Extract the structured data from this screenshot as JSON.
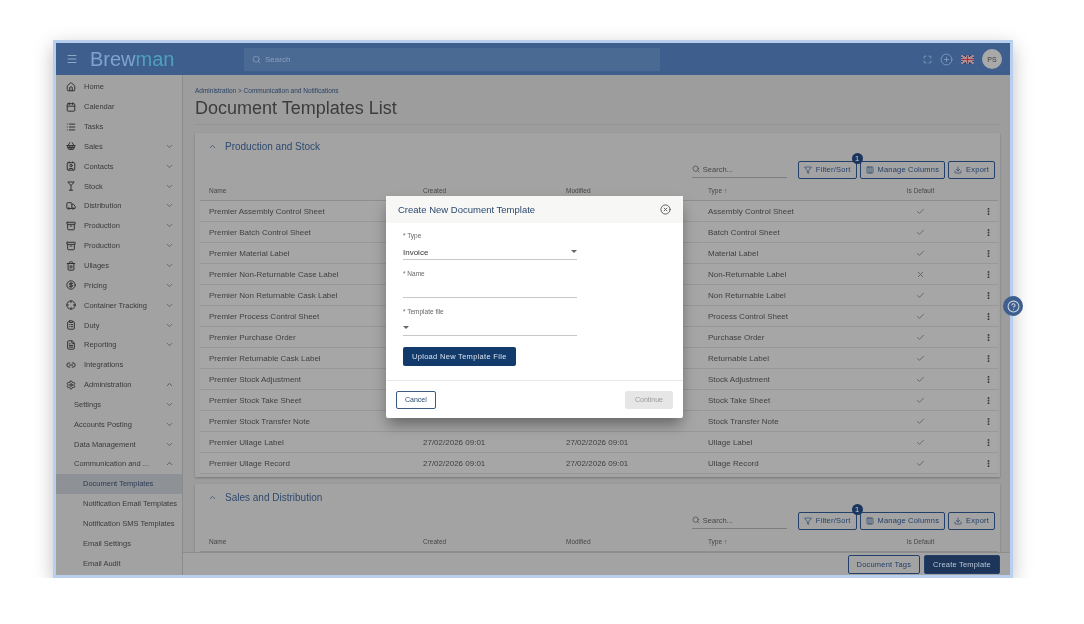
{
  "header": {
    "logo_start": "Brew",
    "logo_end": "man",
    "search_placeholder": "Search",
    "avatar": "PS"
  },
  "sidebar": {
    "items": [
      {
        "label": "Home"
      },
      {
        "label": "Calendar"
      },
      {
        "label": "Tasks"
      },
      {
        "label": "Sales",
        "expanded": false
      },
      {
        "label": "Contacts",
        "expanded": false
      },
      {
        "label": "Stock",
        "expanded": false
      },
      {
        "label": "Distribution",
        "expanded": false
      },
      {
        "label": "Production",
        "expanded": false
      },
      {
        "label": "Production",
        "expanded": false
      },
      {
        "label": "Ullages",
        "expanded": false
      },
      {
        "label": "Pricing",
        "expanded": false
      },
      {
        "label": "Container Tracking",
        "expanded": false
      },
      {
        "label": "Duty",
        "expanded": false
      },
      {
        "label": "Reporting",
        "expanded": false
      },
      {
        "label": "Integrations"
      },
      {
        "label": "Administration",
        "expanded": true,
        "children": [
          {
            "label": "Settings",
            "expanded": false
          },
          {
            "label": "Accounts Posting",
            "expanded": false
          },
          {
            "label": "Data Management",
            "expanded": false
          },
          {
            "label": "Communication and ...",
            "expanded": true,
            "children": [
              {
                "label": "Document Templates",
                "selected": true
              },
              {
                "label": "Notification Email Templates",
                "selected": false
              },
              {
                "label": "Notification SMS Templates",
                "selected": false
              },
              {
                "label": "Email Settings",
                "selected": false
              },
              {
                "label": "Email Audit",
                "selected": false
              }
            ]
          }
        ]
      }
    ]
  },
  "breadcrumb": "Administration > Communication and Notifications",
  "title": "Document Templates List",
  "sections": [
    {
      "title": "Production and Stock",
      "expanded": true,
      "search_placeholder": "Search...",
      "filter_badge": "1",
      "buttons": [
        "Filter/Sort",
        "Manage Columns",
        "Export"
      ],
      "columns": [
        {
          "label": "Name"
        },
        {
          "label": "Created"
        },
        {
          "label": "Modified"
        },
        {
          "label": "Type",
          "sort": "↑"
        },
        {
          "label": "Is Default"
        }
      ],
      "rows": [
        {
          "name": "Premier Assembly Control Sheet",
          "type": "Assembly Control Sheet",
          "is_default": true
        },
        {
          "name": "Premier Batch Control Sheet",
          "type": "Batch Control Sheet",
          "is_default": true
        },
        {
          "name": "Premier Material Label",
          "type": "Material Label",
          "is_default": true
        },
        {
          "name": "Premier Non-Returnable Case Label",
          "type": "Non-Returnable Label",
          "is_default": false
        },
        {
          "name": "Premier Non Returnable Cask Label",
          "type": "Non Returnable Label",
          "is_default": true
        },
        {
          "name": "Premier Process Control Sheet",
          "type": "Process Control Sheet",
          "is_default": true
        },
        {
          "name": "Premier Purchase Order",
          "type": "Purchase Order",
          "is_default": true
        },
        {
          "name": "Premier Returnable Cask Label",
          "type": "Returnable Label",
          "is_default": true
        },
        {
          "name": "Premier Stock Adjustment",
          "type": "Stock Adjustment",
          "is_default": true
        },
        {
          "name": "Premier Stock Take Sheet",
          "type": "Stock Take Sheet",
          "is_default": true
        },
        {
          "name": "Premier Stock Transfer Note",
          "type": "Stock Transfer Note",
          "is_default": true
        },
        {
          "name": "Premier Ullage Label",
          "created": "27/02/2026 09:01",
          "modified": "27/02/2026 09:01",
          "type": "Ullage Label",
          "is_default": true
        },
        {
          "name": "Premier Ullage Record",
          "created": "27/02/2026 09:01",
          "modified": "27/02/2026 09:01",
          "type": "Ullage Record",
          "is_default": true
        }
      ]
    },
    {
      "title": "Sales and Distribution",
      "expanded": true,
      "search_placeholder": "Search...",
      "filter_badge": "1",
      "buttons": [
        "Filter/Sort",
        "Manage Columns",
        "Export"
      ],
      "columns": [
        {
          "label": "Name"
        },
        {
          "label": "Created"
        },
        {
          "label": "Modified"
        },
        {
          "label": "Type",
          "sort": "↑"
        },
        {
          "label": "Is Default"
        }
      ]
    }
  ],
  "footer_buttons": [
    {
      "label": "Document Tags",
      "kind": "outline"
    },
    {
      "label": "Create Template",
      "kind": "primary"
    }
  ],
  "modal": {
    "title": "Create New Document Template",
    "fields": [
      {
        "label": "* Type",
        "kind": "select",
        "value": "Invoice"
      },
      {
        "label": "* Name",
        "kind": "text"
      },
      {
        "label": "* Template file",
        "kind": "select"
      }
    ],
    "upload_button": "Upload New Template File",
    "cancel": "Cancel",
    "continue": {
      "label": "Continue",
      "disabled": true
    }
  }
}
